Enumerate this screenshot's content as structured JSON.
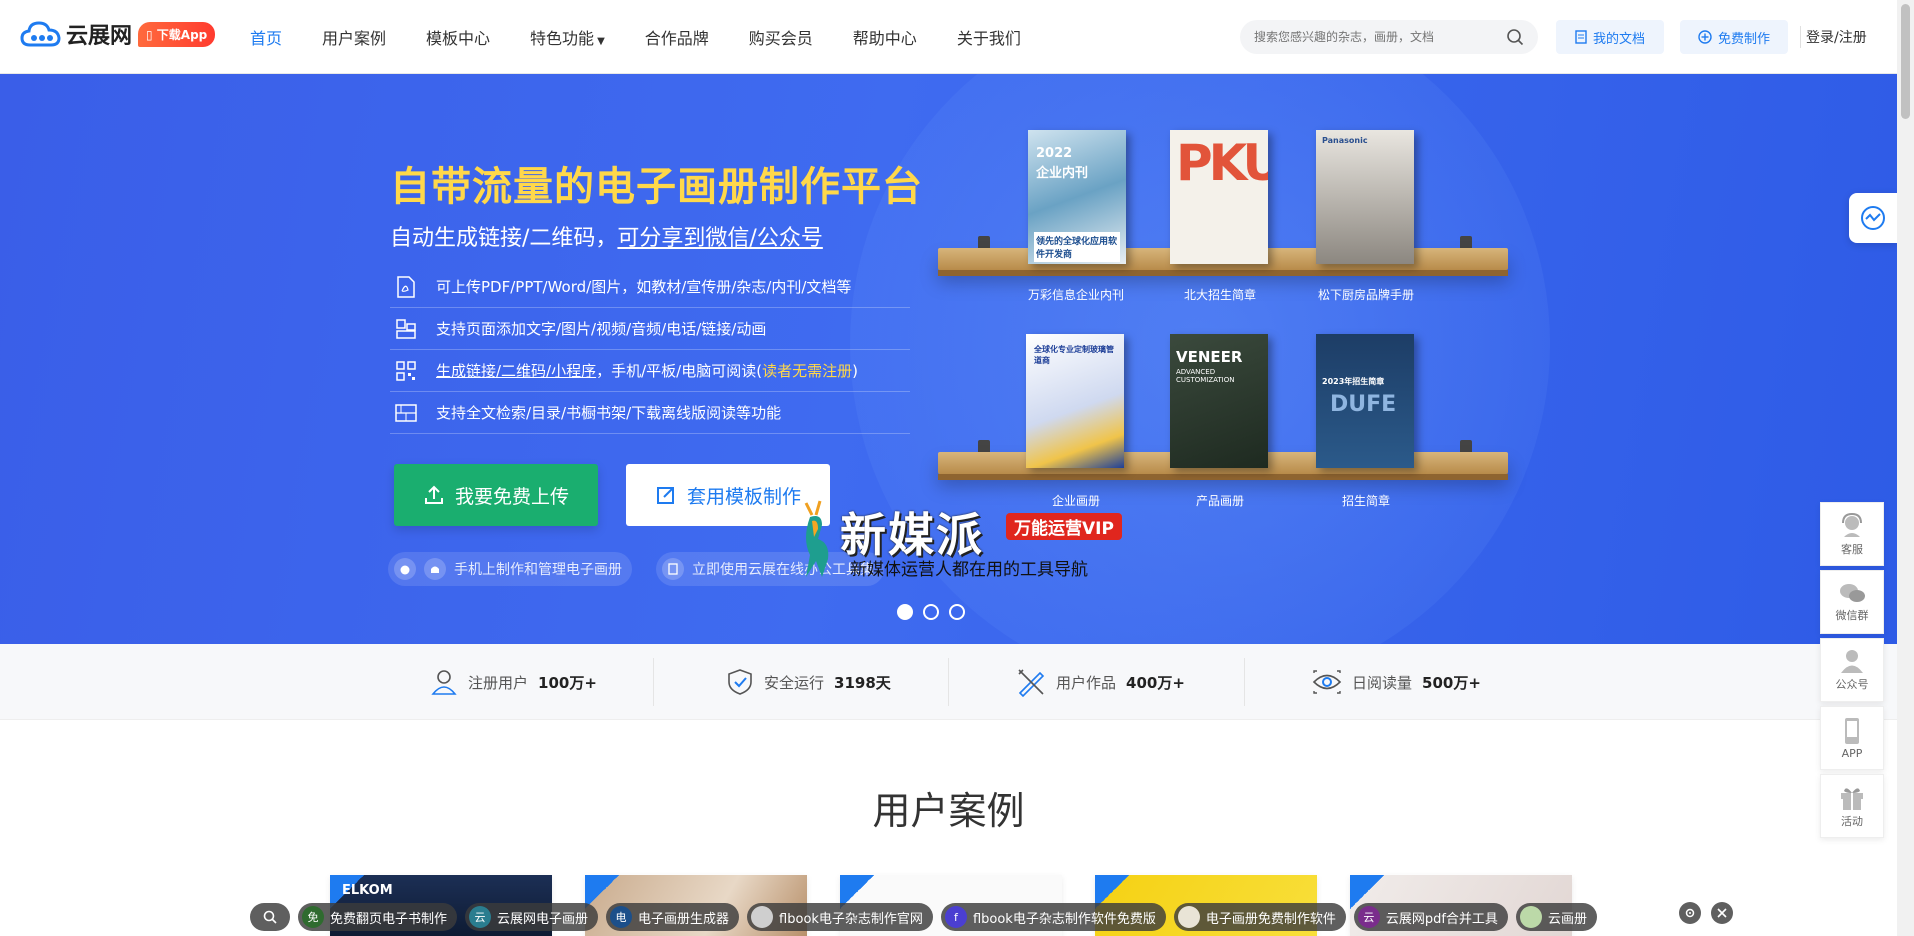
{
  "header": {
    "logo_text": "云展网",
    "app_badge": "下载App",
    "nav": [
      {
        "label": "首页"
      },
      {
        "label": "用户案例"
      },
      {
        "label": "模板中心"
      },
      {
        "label": "特色功能"
      },
      {
        "label": "合作品牌"
      },
      {
        "label": "购买会员"
      },
      {
        "label": "帮助中心"
      },
      {
        "label": "关于我们"
      }
    ],
    "search_placeholder": "搜索您感兴趣的杂志，画册，文档",
    "my_docs": "我的文档",
    "free_make": "免费制作",
    "login": "登录/注册"
  },
  "hero": {
    "title": "自带流量的电子画册制作平台",
    "sub_prefix": "自动生成链接/二维码，",
    "sub_link": "可分享到微信/公众号",
    "features": [
      {
        "text": "可上传PDF/PPT/Word/图片，如教材/宣传册/杂志/内刊/文档等"
      },
      {
        "text": "支持页面添加文字/图片/视频/音频/电话/链接/动画"
      },
      {
        "text_link": "生成链接/二维码/小程序",
        "text_mid": "，手机/平板/电脑可阅读(",
        "text_hl": "读者无需注册",
        "text_end": ")"
      },
      {
        "text": "支持全文检索/目录/书橱书架/下载离线版阅读等功能"
      }
    ],
    "btn_upload": "我要免费上传",
    "btn_template": "套用模板制作",
    "pill_mobile": "手机上制作和管理电子画册",
    "pill_office": "立即使用云展在线办公工具集"
  },
  "books": [
    {
      "label": "万彩信息企业内刊",
      "cover_year": "2022",
      "cover_title": "企业内刊",
      "cover_sub": "领先的全球化应用软件开发商"
    },
    {
      "label": "北大招生简章",
      "cover_title": "PKU"
    },
    {
      "label": "松下厨房品牌手册",
      "cover_title": "Panasonic"
    },
    {
      "label": "企业画册",
      "cover_title": "全球化专业定制玻璃管道商"
    },
    {
      "label": "产品画册",
      "cover_title": "VENEER",
      "cover_sub": "ADVANCED CUSTOMIZATION"
    },
    {
      "label": "招生简章",
      "cover_title": "DUFE",
      "cover_sub": "2023年招生简章"
    }
  ],
  "watermark": {
    "title": "新媒派",
    "vip": "万能运营VIP",
    "sub": "新媒体运营人都在用的工具导航"
  },
  "stats": [
    {
      "label": "注册用户",
      "value": "100万+"
    },
    {
      "label": "安全运行",
      "value": "3198天"
    },
    {
      "label": "用户作品",
      "value": "400万+"
    },
    {
      "label": "日阅读量",
      "value": "500万+"
    }
  ],
  "section_title": "用户案例",
  "cases": [
    {
      "title": "ELKOM"
    }
  ],
  "float": [
    {
      "label": "客服"
    },
    {
      "label": "微信群"
    },
    {
      "label": "公众号"
    },
    {
      "label": "APP"
    },
    {
      "label": "活动"
    }
  ],
  "tags": [
    {
      "label": "免费翻页电子书制作",
      "icon": "免",
      "color": "#2f6b2f"
    },
    {
      "label": "云展网电子画册",
      "icon": "云",
      "color": "#2a7d8f"
    },
    {
      "label": "电子画册生成器",
      "icon": "电",
      "color": "#1c4f8a"
    },
    {
      "label": "flbook电子杂志制作官网",
      "icon": "",
      "color": "#cfcfcf"
    },
    {
      "label": "flbook电子杂志制作软件免费版",
      "icon": "f",
      "color": "#4b3fd1"
    },
    {
      "label": "电子画册免费制作软件",
      "icon": "",
      "color": "#e9e4d6"
    },
    {
      "label": "云展网pdf合并工具",
      "icon": "云",
      "color": "#7a2d8c"
    },
    {
      "label": "云画册",
      "icon": "",
      "color": "#bcd9a8"
    }
  ]
}
